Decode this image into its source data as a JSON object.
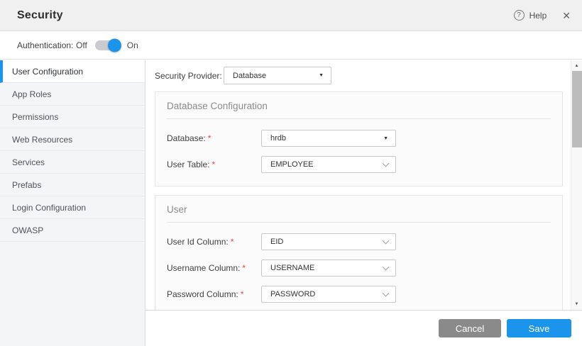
{
  "header": {
    "title": "Security",
    "help_label": "Help"
  },
  "icons": {
    "help_glyph": "?",
    "close_glyph": "✕",
    "select_triangle": "▼",
    "scroll_up": "▲",
    "scroll_down": "▼"
  },
  "auth": {
    "label": "Authentication:",
    "off_label": "Off",
    "on_label": "On",
    "state": "On"
  },
  "sidebar": {
    "items": [
      {
        "label": "User Configuration",
        "active": true
      },
      {
        "label": "App Roles",
        "active": false
      },
      {
        "label": "Permissions",
        "active": false
      },
      {
        "label": "Web Resources",
        "active": false
      },
      {
        "label": "Services",
        "active": false
      },
      {
        "label": "Prefabs",
        "active": false
      },
      {
        "label": "Login Configuration",
        "active": false
      },
      {
        "label": "OWASP",
        "active": false
      }
    ]
  },
  "provider": {
    "label": "Security Provider:",
    "value": "Database"
  },
  "required_marker": "*",
  "sections": [
    {
      "title": "Database Configuration",
      "fields": [
        {
          "label": "Database:",
          "required": true,
          "value": "hrdb"
        },
        {
          "label": "User Table:",
          "required": true,
          "value": "EMPLOYEE"
        }
      ]
    },
    {
      "title": "User",
      "fields": [
        {
          "label": "User Id Column:",
          "required": true,
          "value": "EID"
        },
        {
          "label": "Username Column:",
          "required": true,
          "value": "USERNAME"
        },
        {
          "label": "Password Column:",
          "required": true,
          "value": "PASSWORD"
        }
      ]
    }
  ],
  "footer": {
    "cancel_label": "Cancel",
    "save_label": "Save"
  },
  "colors": {
    "accent_blue": "#1b95ec",
    "cancel_gray": "#8a8a8a",
    "required_red": "#e5453a"
  }
}
